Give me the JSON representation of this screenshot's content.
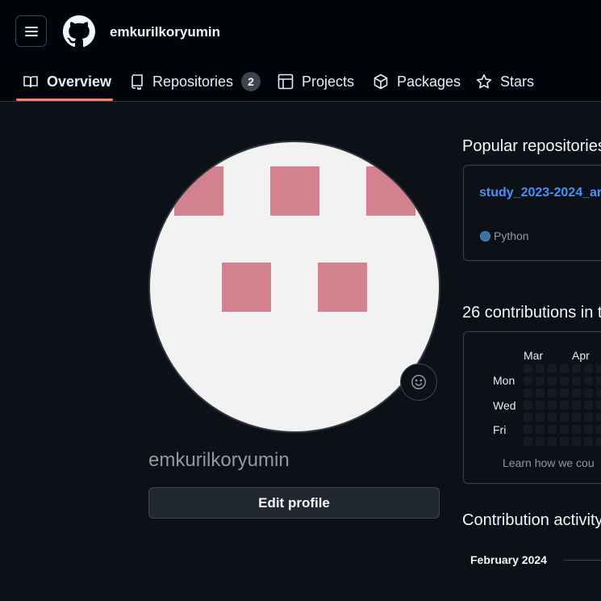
{
  "header": {
    "username": "emkurilkoryumin"
  },
  "nav": {
    "overview": "Overview",
    "repositories": "Repositories",
    "repositories_count": "2",
    "projects": "Projects",
    "packages": "Packages",
    "stars": "Stars"
  },
  "profile": {
    "name": "emkurilkoryumin",
    "edit_button": "Edit profile",
    "avatar_color": "#d4818f"
  },
  "popular": {
    "title": "Popular repositories",
    "repos": [
      {
        "name": "study_2023-2024_ar",
        "language": "Python",
        "language_color": "#3572a5"
      }
    ]
  },
  "contributions": {
    "title": "26 contributions in t",
    "months": [
      "Mar",
      "Apr"
    ],
    "days": [
      "Mon",
      "Wed",
      "Fri"
    ],
    "learn": "Learn how we cou"
  },
  "activity": {
    "title": "Contribution activity",
    "month": "February 2024"
  }
}
